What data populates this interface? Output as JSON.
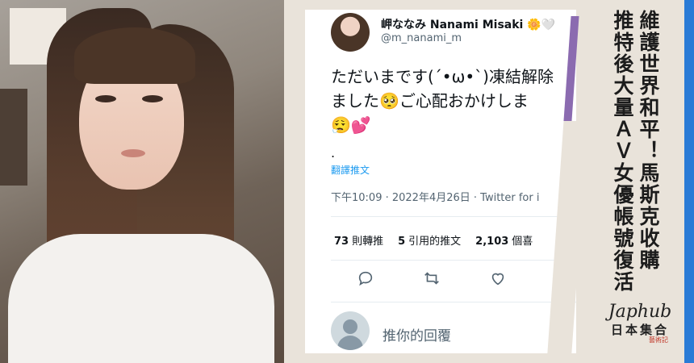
{
  "tweet": {
    "display_name": "岬ななみ Nanami Misaki",
    "name_emojis": "🌼🤍",
    "handle": "@m_nanami_m",
    "text_line1": "ただいまです(´•ω•`)凍結解除",
    "text_line2": "ました🥺ご心配おかけしま",
    "text_line3": "😮‍💨💕",
    "trailing_dot": ".",
    "translate_label": "翻譯推文",
    "meta": "下午10:09 · 2022年4月26日 · Twitter for i",
    "stats": {
      "retweets_count": "73",
      "retweets_label": "則轉推",
      "quotes_count": "5",
      "quotes_label": "引用的推文",
      "likes_count": "2,103",
      "likes_label": "個喜"
    },
    "reply_placeholder": "推你的回覆"
  },
  "headline": {
    "line1": "維護世界和平！馬斯克收購",
    "line2": "推特後大量ＡＶ女優帳號復活"
  },
  "brand": {
    "logo": "Japhub",
    "name": "日本集合",
    "sub": "藝術記"
  },
  "icons": [
    "reply-icon",
    "retweet-icon",
    "like-icon",
    "default-avatar-icon"
  ],
  "colors": {
    "accent": "#8b6bb0",
    "link": "#1d9bf0",
    "secondary_text": "#536471",
    "strip": "#2a7bd6"
  }
}
